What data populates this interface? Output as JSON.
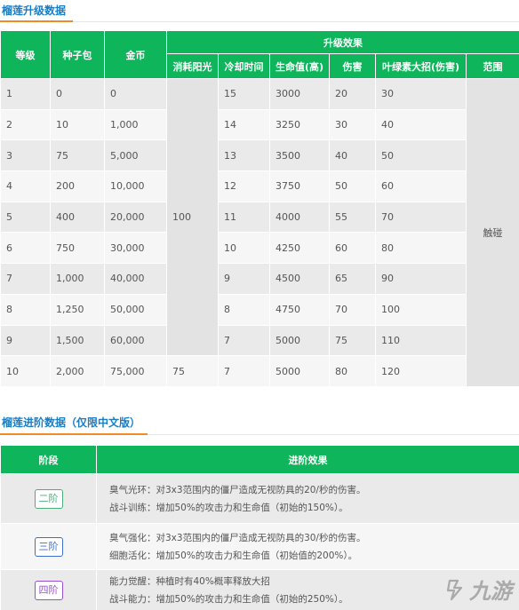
{
  "upgrade": {
    "title": "榴莲升级数据",
    "headers": {
      "level": "等级",
      "seed_pack": "种子包",
      "coins": "金币",
      "effect_group": "升级效果",
      "sun": "消耗阳光",
      "cooldown": "冷却时间",
      "health": "生命值(高)",
      "damage": "伤害",
      "leaf_skill": "叶绿素大招(伤害)",
      "range": "范围"
    },
    "rows": [
      {
        "level": "1",
        "seed": "0",
        "coins": "0",
        "cooldown": "15",
        "health": "3000",
        "damage": "20",
        "leaf": "30"
      },
      {
        "level": "2",
        "seed": "10",
        "coins": "1,000",
        "cooldown": "14",
        "health": "3250",
        "damage": "30",
        "leaf": "40"
      },
      {
        "level": "3",
        "seed": "75",
        "coins": "5,000",
        "cooldown": "13",
        "health": "3500",
        "damage": "40",
        "leaf": "50"
      },
      {
        "level": "4",
        "seed": "200",
        "coins": "10,000",
        "cooldown": "12",
        "health": "3750",
        "damage": "50",
        "leaf": "60"
      },
      {
        "level": "5",
        "seed": "400",
        "coins": "20,000",
        "cooldown": "11",
        "health": "4000",
        "damage": "55",
        "leaf": "70"
      },
      {
        "level": "6",
        "seed": "750",
        "coins": "30,000",
        "cooldown": "10",
        "health": "4250",
        "damage": "60",
        "leaf": "80"
      },
      {
        "level": "7",
        "seed": "1,000",
        "coins": "40,000",
        "cooldown": "9",
        "health": "4500",
        "damage": "65",
        "leaf": "90"
      },
      {
        "level": "8",
        "seed": "1,250",
        "coins": "50,000",
        "cooldown": "8",
        "health": "4750",
        "damage": "70",
        "leaf": "100"
      },
      {
        "level": "9",
        "seed": "1,500",
        "coins": "60,000",
        "cooldown": "7",
        "health": "5000",
        "damage": "75",
        "leaf": "110"
      },
      {
        "level": "10",
        "seed": "2,000",
        "coins": "75,000",
        "cooldown": "7",
        "health": "5000",
        "damage": "80",
        "leaf": "120"
      }
    ],
    "sun_merged": "100",
    "sun_last": "75",
    "range_merged": "触碰"
  },
  "advance": {
    "title": "榴莲进阶数据（仅限中文版）",
    "headers": {
      "stage": "阶段",
      "effect": "进阶效果"
    },
    "rows": [
      {
        "stage": "二阶",
        "line1": "臭气光环：对3x3范围内的僵尸造成无视防具的20/秒的伤害。",
        "line2": "战斗训练：增加50%的攻击力和生命值（初始的150%）。",
        "color": "#4caf7a"
      },
      {
        "stage": "三阶",
        "line1": "臭气强化：对3x3范围内的僵尸造成无视防具的30/秒的伤害。",
        "line2": "细胞活化：增加50%的攻击力和生命值（初始值的200%）。",
        "color": "#3d6fd0"
      },
      {
        "stage": "四阶",
        "line1": "能力觉醒：种植时有40%概率释放大招",
        "line2": "战斗能力：增加50%的攻击力和生命值（初始的250%）。",
        "color": "#9b4fd1"
      }
    ]
  },
  "watermark": {
    "text": "九游",
    "icon": "jiuyou-logo-icon"
  }
}
